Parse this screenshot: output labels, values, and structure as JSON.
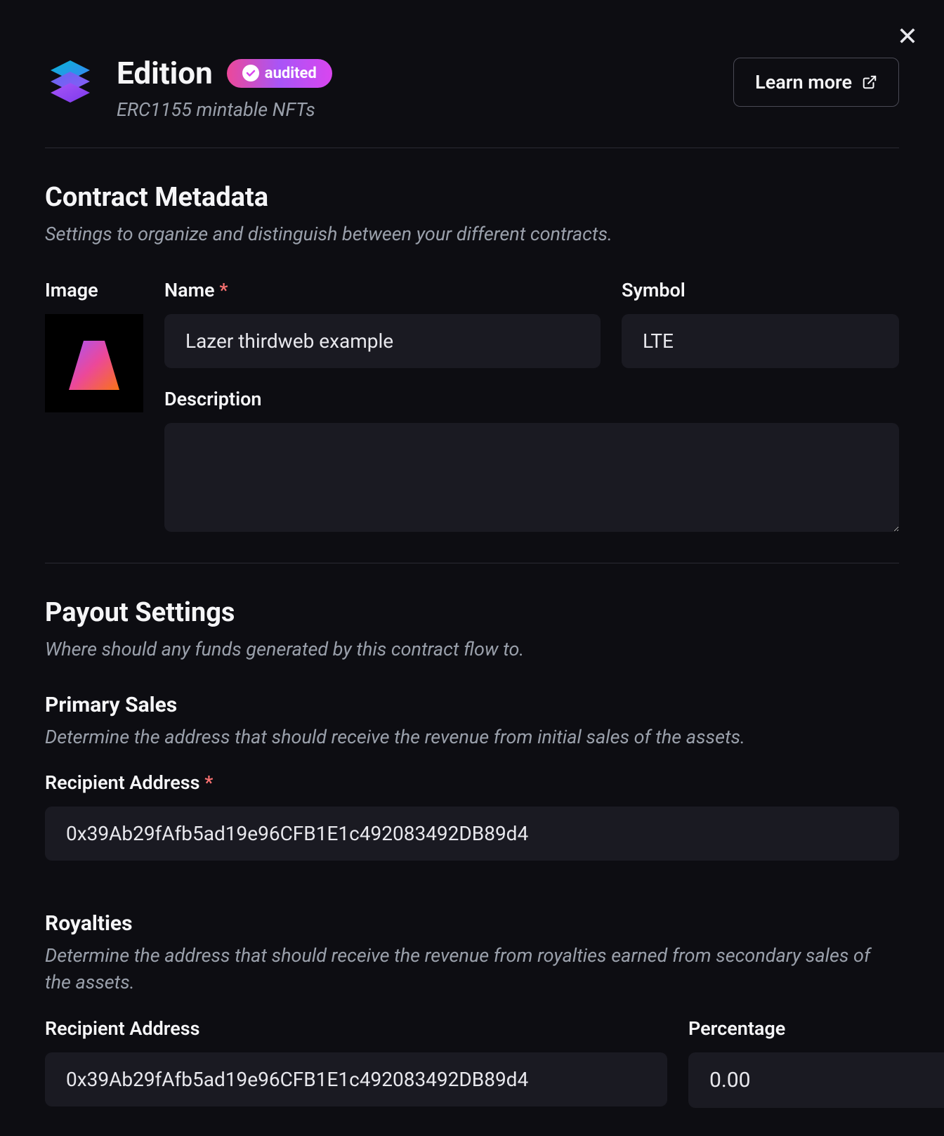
{
  "header": {
    "title": "Edition",
    "audited_label": "audited",
    "subtitle": "ERC1155 mintable NFTs",
    "learn_more_label": "Learn more"
  },
  "metadata": {
    "section_title": "Contract Metadata",
    "section_desc": "Settings to organize and distinguish between your different contracts.",
    "image_label": "Image",
    "name_label": "Name",
    "name_value": "Lazer thirdweb example",
    "symbol_label": "Symbol",
    "symbol_value": "LTE",
    "description_label": "Description",
    "description_value": ""
  },
  "payout": {
    "section_title": "Payout Settings",
    "section_desc": "Where should any funds generated by this contract flow to.",
    "primary_title": "Primary Sales",
    "primary_desc": "Determine the address that should receive the revenue from initial sales of the assets.",
    "recipient_label": "Recipient Address",
    "recipient_value": "0x39Ab29fAfb5ad19e96CFB1E1c492083492DB89d4",
    "royalties_title": "Royalties",
    "royalties_desc": "Determine the address that should receive the revenue from royalties earned from secondary sales of the assets.",
    "royalties_recipient_label": "Recipient Address",
    "royalties_recipient_value": "0x39Ab29fAfb5ad19e96CFB1E1c492083492DB89d4",
    "percentage_label": "Percentage",
    "percentage_value": "0.00",
    "percentage_unit": "%"
  }
}
